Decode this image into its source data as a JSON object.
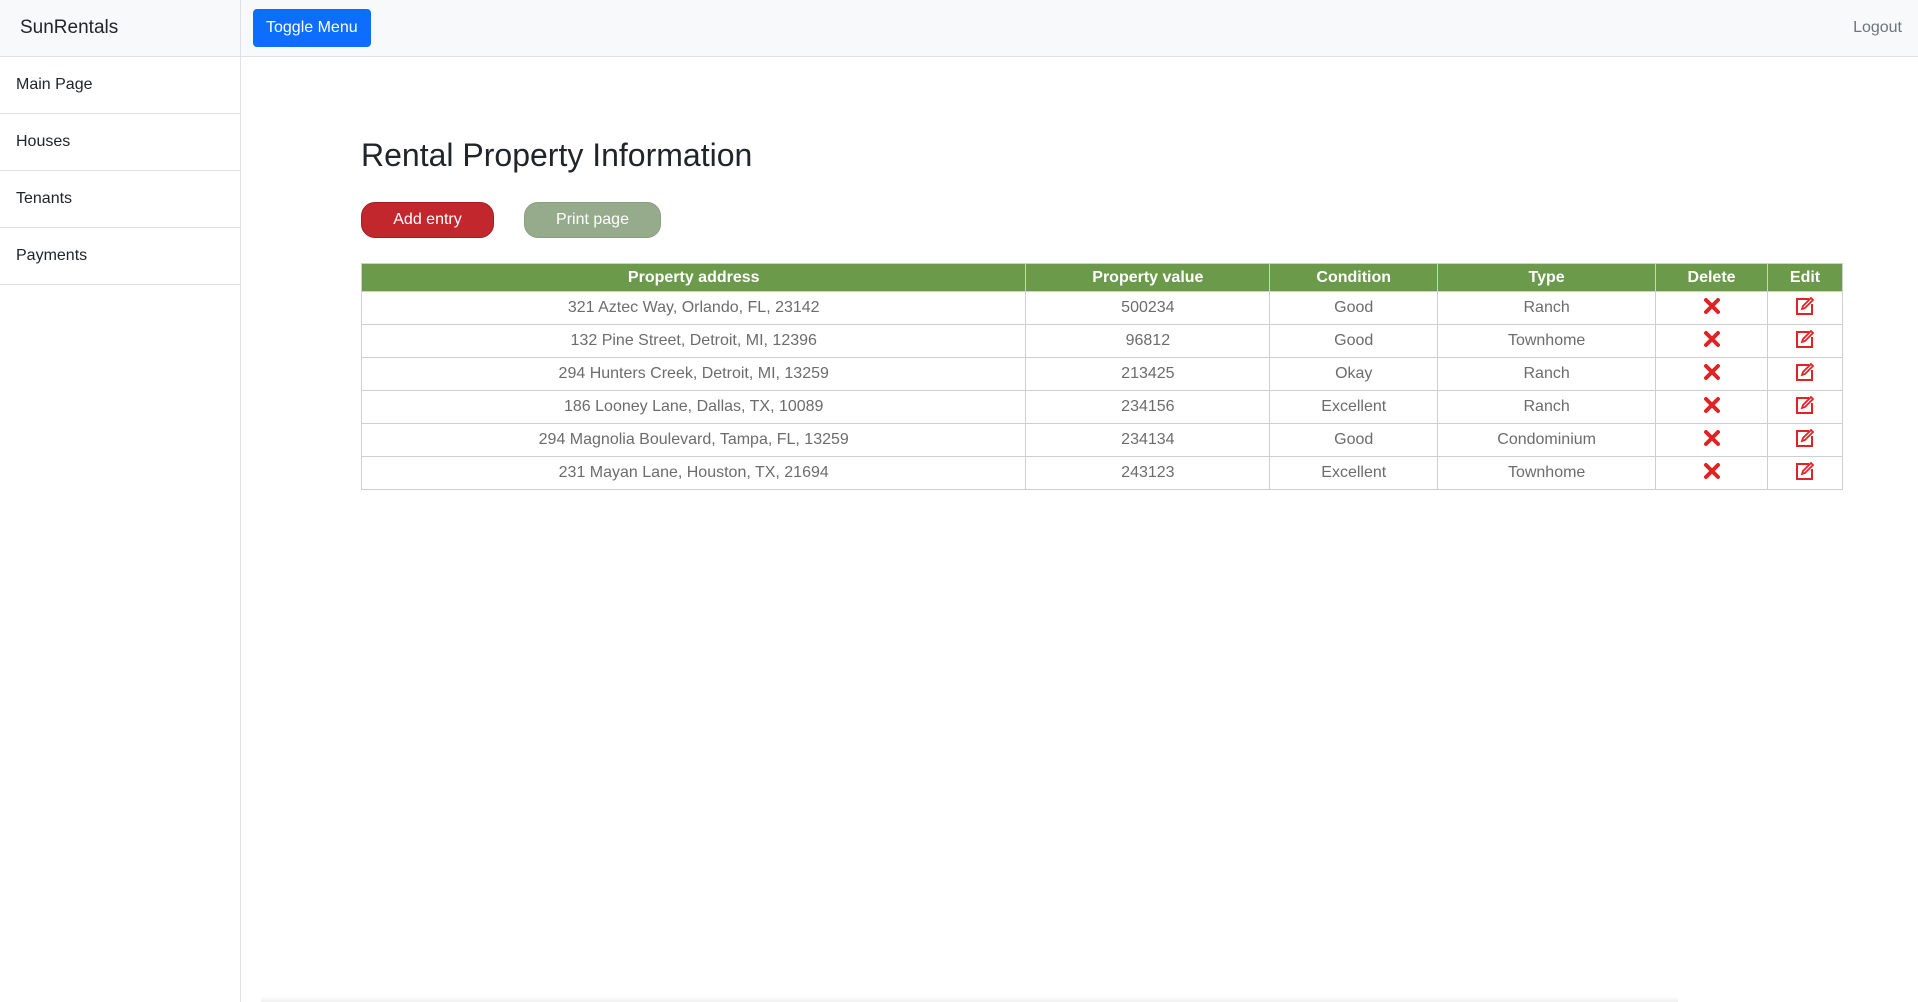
{
  "app": {
    "brand": "SunRentals"
  },
  "sidebar": {
    "items": [
      {
        "label": "Main Page"
      },
      {
        "label": "Houses"
      },
      {
        "label": "Tenants"
      },
      {
        "label": "Payments"
      }
    ]
  },
  "topbar": {
    "toggle_label": "Toggle Menu",
    "logout_label": "Logout"
  },
  "main": {
    "title": "Rental Property Information",
    "add_label": "Add entry",
    "print_label": "Print page"
  },
  "table": {
    "headers": [
      "Property address",
      "Property value",
      "Condition",
      "Type",
      "Delete",
      "Edit"
    ],
    "rows": [
      [
        "321 Aztec Way, Orlando, FL, 23142",
        "500234",
        "Good",
        "Ranch"
      ],
      [
        "132 Pine Street, Detroit, MI, 12396",
        "96812",
        "Good",
        "Townhome"
      ],
      [
        "294 Hunters Creek, Detroit, MI, 13259",
        "213425",
        "Okay",
        "Ranch"
      ],
      [
        "186 Looney Lane, Dallas, TX, 10089",
        "234156",
        "Excellent",
        "Ranch"
      ],
      [
        "294 Magnolia Boulevard, Tampa, FL, 13259",
        "234134",
        "Good",
        "Condominium"
      ],
      [
        "231 Mayan Lane, Houston, TX, 21694",
        "243123",
        "Excellent",
        "Townhome"
      ]
    ]
  },
  "colors": {
    "header_green": "#6b9a4a",
    "add_red": "#c1272d",
    "print_green": "#96ab8b",
    "icon_red": "#e02424",
    "toggle_blue": "#0d6efd"
  },
  "icons": {
    "delete": "x-mark-icon",
    "edit": "edit-square-icon"
  }
}
